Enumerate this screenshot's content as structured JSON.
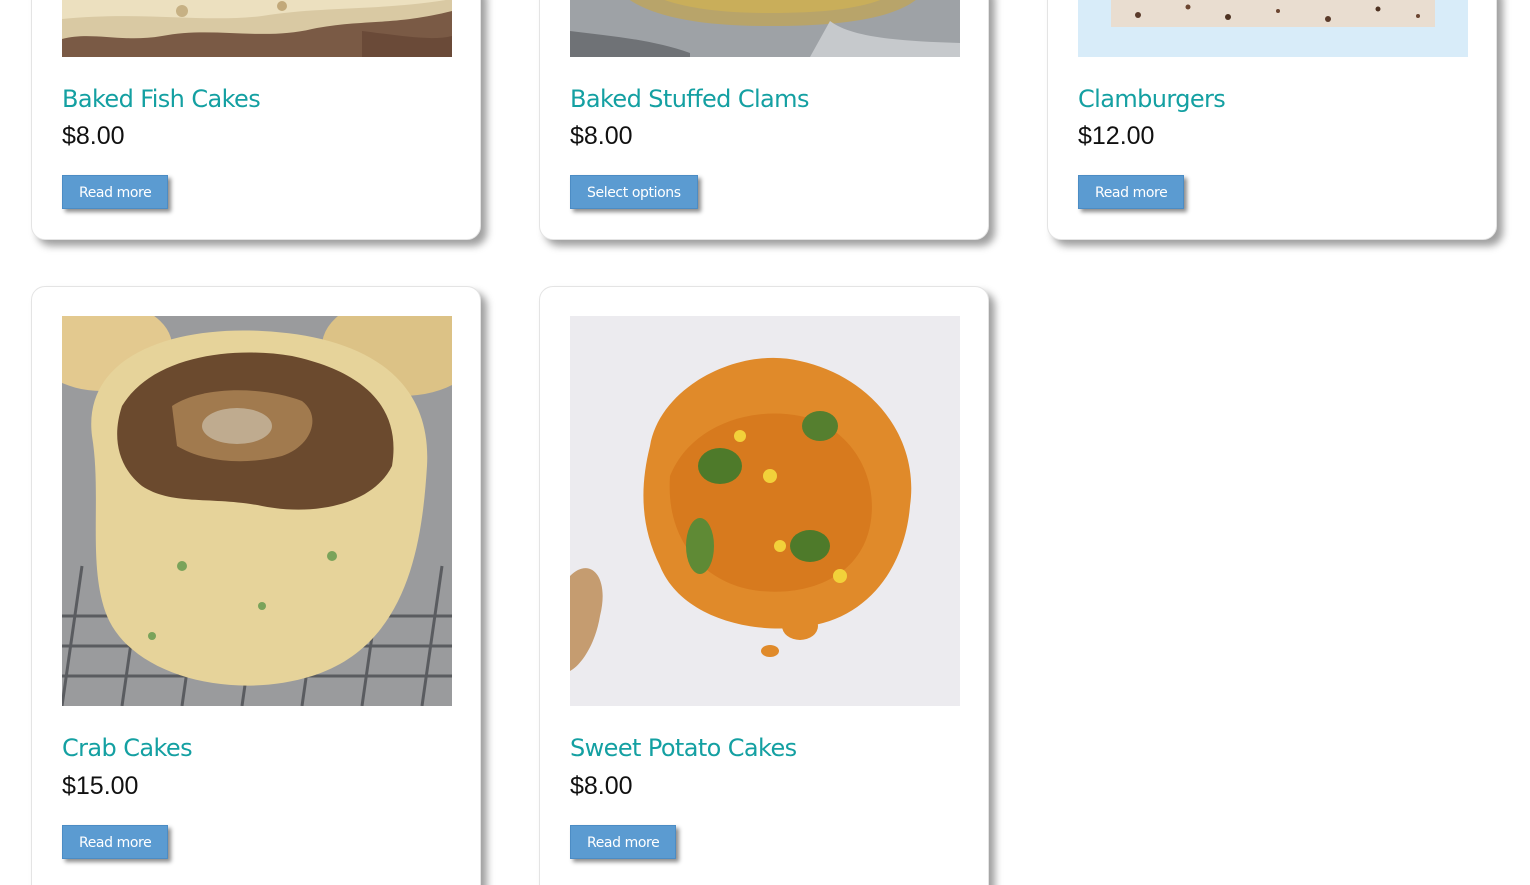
{
  "products": [
    {
      "title": "Baked Fish Cakes",
      "price": "$8.00",
      "button": "Read more",
      "image": "fish-cakes-photo"
    },
    {
      "title": "Baked Stuffed Clams",
      "price": "$8.00",
      "button": "Select options",
      "image": "stuffed-clams-photo"
    },
    {
      "title": "Clamburgers",
      "price": "$12.00",
      "button": "Read more",
      "image": "clamburgers-photo"
    },
    {
      "title": "Crab Cakes",
      "price": "$15.00",
      "button": "Read more",
      "image": "crab-cakes-photo"
    },
    {
      "title": "Sweet Potato Cakes",
      "price": "$8.00",
      "button": "Read more",
      "image": "sweet-potato-cakes-photo"
    }
  ],
  "colors": {
    "title": "#14a0a2",
    "button": "#5b9bd1",
    "price": "#111111"
  }
}
